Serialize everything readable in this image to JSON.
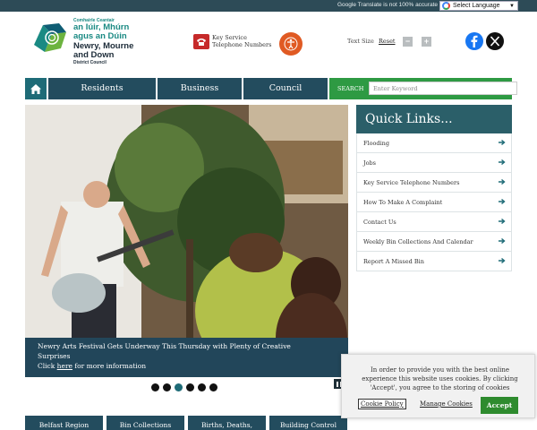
{
  "topbar": {
    "translate_note": "Google Translate is not 100% accurate",
    "language_select": "Select Language"
  },
  "logo": {
    "irish_top": "Comhairle Ceantair",
    "irish_line1": "an Iúir, Mhúrn",
    "irish_line2": "agus an Dúin",
    "english_line1": "Newry, Mourne",
    "english_line2": "and Down",
    "english_line3": "District Council"
  },
  "header": {
    "phone_line1": "Key Service",
    "phone_line2": "Telephone Numbers",
    "text_size_label": "Text Size",
    "reset_label": "Reset",
    "size_minus": "−",
    "size_plus": "+"
  },
  "nav": {
    "residents": "Residents",
    "business": "Business",
    "council": "Council",
    "search_label": "SEARCH",
    "search_placeholder": "Enter Keyword"
  },
  "slider": {
    "caption_line1": "Newry Arts Festival Gets Underway This Thursday with Plenty of Creative",
    "caption_line2": "Surprises",
    "caption_pre": "Click",
    "caption_link": "here",
    "caption_post": "for more information",
    "dots_total": 6,
    "active_dot": 3
  },
  "quick_links": {
    "title": "Quick Links...",
    "items": [
      "Flooding",
      "Jobs",
      "Key Service Telephone Numbers",
      "How To Make A Complaint",
      "Contact Us",
      "Weekly Bin Collections And Calendar",
      "Report A Missed Bin"
    ]
  },
  "bottom_tabs": [
    "Belfast Region",
    "Bin Collections",
    "Births, Deaths,",
    "Building Control"
  ],
  "cookie": {
    "message": "In order to provide you with the best online experience this website uses cookies. By clicking 'Accept', you agree to the storing of cookies",
    "policy": "Cookie Policy",
    "manage": "Manage Cookies",
    "accept": "Accept"
  },
  "colors": {
    "nav_blue": "#234c5e",
    "search_green": "#2e9a43",
    "quick_links_teal": "#2b5f69",
    "accept_green": "#2e8b2e"
  }
}
